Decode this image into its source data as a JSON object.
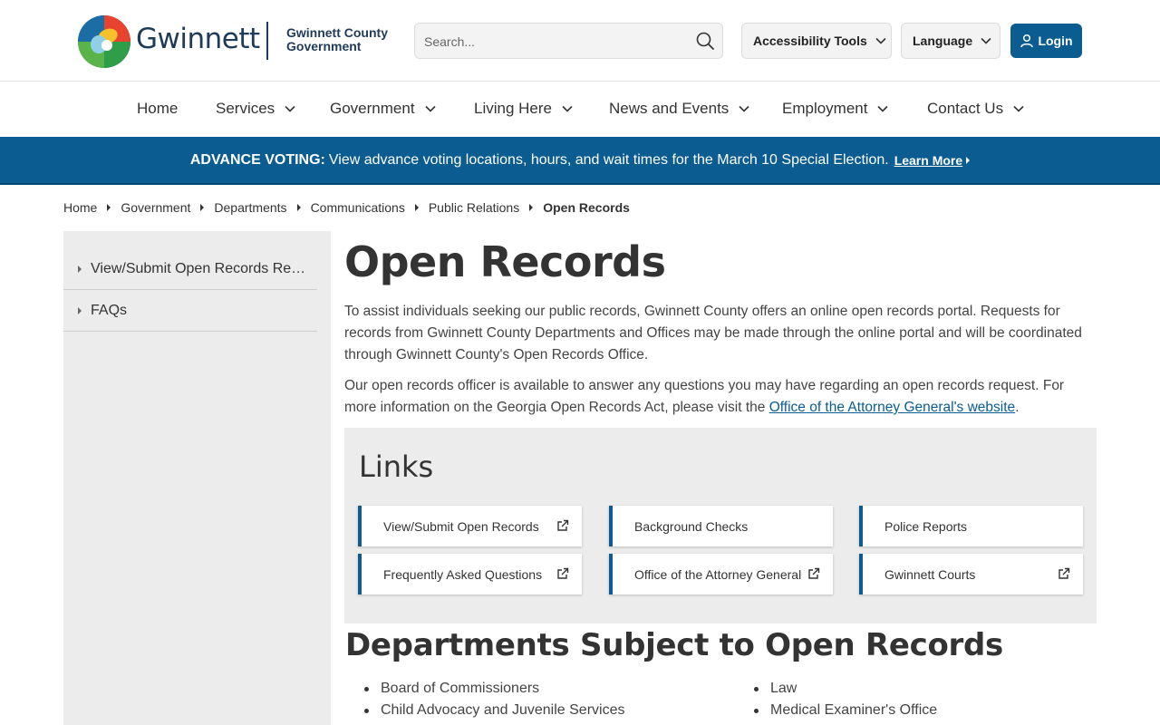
{
  "header": {
    "brand": "Gwinnett",
    "county_line1": "Gwinnett County",
    "county_line2": "Government",
    "search_placeholder": "Search...",
    "accessibility_label": "Accessibility Tools",
    "language_label": "Language",
    "login_label": "Login"
  },
  "nav": {
    "items": [
      {
        "label": "Home"
      },
      {
        "label": "Services"
      },
      {
        "label": "Government"
      },
      {
        "label": "Living Here"
      },
      {
        "label": "News and Events"
      },
      {
        "label": "Employment"
      },
      {
        "label": "Contact Us"
      }
    ]
  },
  "alert": {
    "heading": "ADVANCE VOTING:",
    "text": "View advance voting locations, hours, and wait times for the March 10 Special Election.",
    "link": "Learn More"
  },
  "breadcrumb": [
    "Home",
    "Government",
    "Departments",
    "Communications",
    "Public Relations",
    "Open Records"
  ],
  "sidebar": {
    "items": [
      {
        "label": "View/Submit Open Records Requests"
      },
      {
        "label": "FAQs"
      }
    ]
  },
  "main": {
    "title": "Open Records",
    "para1": "To assist individuals seeking our public records, Gwinnett County offers an online open records portal. Requests for records from Gwinnett County Departments and Offices may be made through the online portal and will be coordinated through Gwinnett County's Open Records Office.",
    "para2_text": "Our open records officer is available to answer any questions you may have regarding an open records request. For more information on the Georgia Open Records Act, please visit the ",
    "para2_link": "Office of the Attorney General's website",
    "para2_end": "."
  },
  "links": {
    "title": "Links",
    "cards": [
      {
        "label": "View/Submit Open Records"
      },
      {
        "label": "Background Checks"
      },
      {
        "label": "Police Reports"
      },
      {
        "label": "Frequently Asked Questions"
      },
      {
        "label": "Office of the Attorney General"
      },
      {
        "label": "Gwinnett Courts"
      }
    ]
  },
  "departments": {
    "title": "Departments Subject to Open Records",
    "col1": [
      "Board of Commissioners",
      "Child Advocacy and Juvenile Services"
    ],
    "col2": [
      "Law",
      "Medical Examiner's Office"
    ]
  },
  "colors": {
    "brand_blue": "#0a5c91",
    "sidebar_bg": "#ececec",
    "text_dark": "#333333"
  }
}
